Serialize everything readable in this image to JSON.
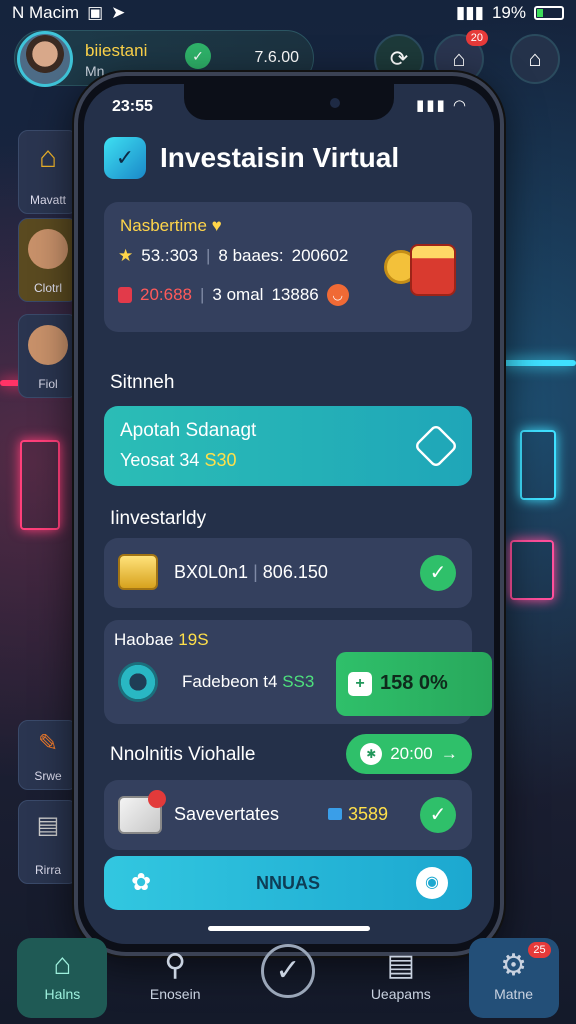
{
  "status_bar": {
    "left_text": "N Macim",
    "battery": "19%"
  },
  "profile": {
    "name": "biiestani",
    "subtitle": "Mn",
    "balance": "7.6.00"
  },
  "top_icons": {
    "notif_badge": "20"
  },
  "side_tiles": [
    "Mavatt",
    "Clotrl",
    "Fiol"
  ],
  "side_tiles_lower": [
    "Srwe",
    "Rirra"
  ],
  "phone": {
    "time": "23:55",
    "app_title": "Investaisin Virtual",
    "summary": {
      "title": "Nasbertime",
      "stat1_value": "53.:303",
      "stat1_label": "8 baaes:",
      "stat1_extra": "200602",
      "stat2_value": "20:688",
      "stat2_label": "3 omal",
      "stat2_extra": "13886"
    },
    "section1_title": "Sitnneh",
    "promo": {
      "title": "Apotah Sdanagt",
      "sub_prefix": "Yeosat 34",
      "sub_value": "S30"
    },
    "section2_title": "Iinvestarldy",
    "holding": {
      "name": "BX0L0n1",
      "value": "806.150"
    },
    "featured": {
      "title_prefix": "Haobae",
      "title_value": "19S",
      "name": "Fadebeon t4",
      "name_value": "SS3",
      "pill_value": "158 0%"
    },
    "section3_title": "Nnolnitis Viohalle",
    "small_pill": "20:00",
    "savings": {
      "name": "Savevertates",
      "value": "3589"
    },
    "cta_label": "NNUAS"
  },
  "nav": [
    {
      "label": "Halns"
    },
    {
      "label": "Enosein"
    },
    {
      "label": ""
    },
    {
      "label": "Ueapams"
    },
    {
      "label": "Matne",
      "badge": "25"
    }
  ]
}
